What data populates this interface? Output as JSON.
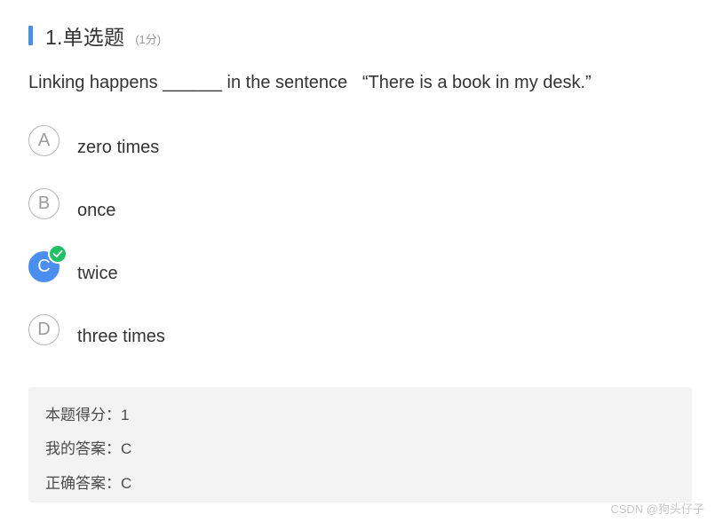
{
  "question": {
    "title": "1.单选题",
    "score": "(1分)",
    "stem": "Linking happens ______ in the sentence   “There is a book in my desk.”"
  },
  "options": [
    {
      "letter": "A",
      "text": "zero times",
      "selected": false
    },
    {
      "letter": "B",
      "text": "once",
      "selected": false
    },
    {
      "letter": "C",
      "text": "twice",
      "selected": true
    },
    {
      "letter": "D",
      "text": "three times",
      "selected": false
    }
  ],
  "result": {
    "score_line": "本题得分：1",
    "my_answer_line": "我的答案：C",
    "correct_answer_line": "正确答案：C"
  },
  "watermark": "CSDN @狗头仔子",
  "colors": {
    "accent_blue": "#4a90e2",
    "selected_blue": "#4a8ff0",
    "check_green": "#21c064",
    "result_bg": "#f3f3f3"
  },
  "icons": {
    "check": "check-icon"
  }
}
